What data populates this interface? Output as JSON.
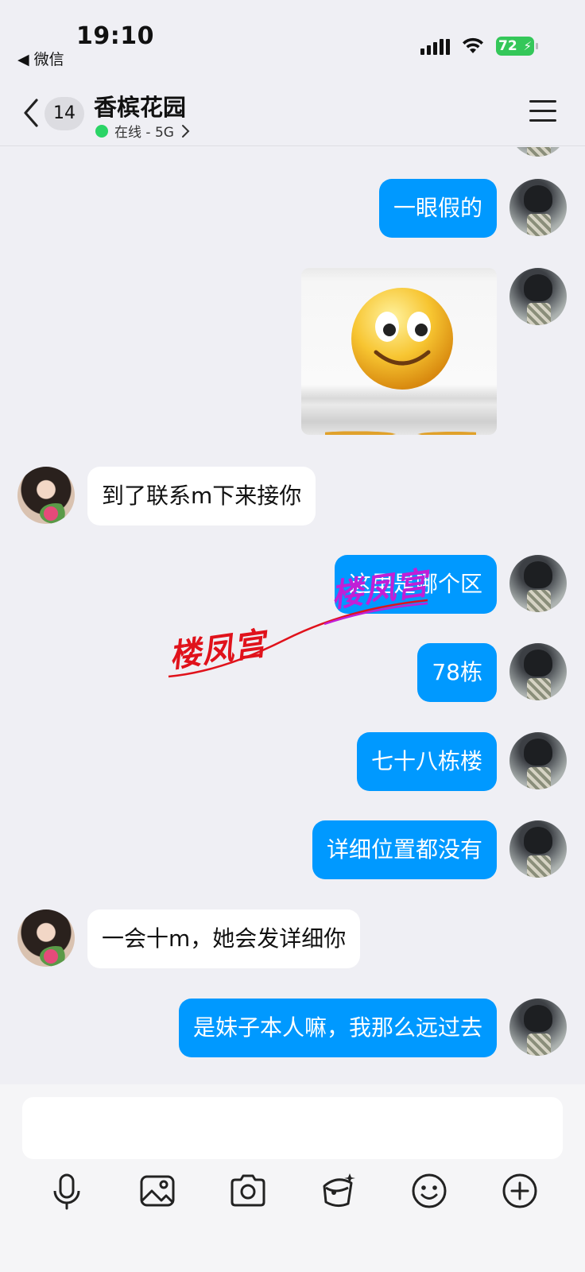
{
  "status_bar": {
    "time": "19:10",
    "back_app": "◀ 微信",
    "battery": "72"
  },
  "header": {
    "unread_count": "14",
    "title": "香槟花园",
    "status": "在线 - 5G",
    "online_color": "#2bd466"
  },
  "messages": [
    {
      "side": "out",
      "type": "text",
      "text": "一眼假的"
    },
    {
      "side": "out",
      "type": "sticker",
      "sticker": "smiley-face-sticker"
    },
    {
      "side": "in",
      "type": "text",
      "text": "到了联系m下来接你"
    },
    {
      "side": "out",
      "type": "text",
      "text": "这里是哪个区"
    },
    {
      "side": "out",
      "type": "text",
      "text": "78栋"
    },
    {
      "side": "out",
      "type": "text",
      "text": "七十八栋楼"
    },
    {
      "side": "out",
      "type": "text",
      "text": "详细位置都没有"
    },
    {
      "side": "in",
      "type": "text",
      "text": "一会十m，她会发详细你"
    },
    {
      "side": "out",
      "type": "text",
      "text": "是妹子本人嘛，我那么远过去"
    }
  ],
  "watermarks": [
    "楼凤宫",
    "楼凤宫"
  ],
  "composer": {
    "placeholder": "",
    "toolbar": [
      "microphone-icon",
      "image-icon",
      "camera-icon",
      "red-packet-icon",
      "emoji-icon",
      "plus-icon"
    ]
  },
  "colors": {
    "outgoing_bubble": "#0099ff",
    "incoming_bubble": "#ffffff",
    "background": "#efeff4"
  }
}
